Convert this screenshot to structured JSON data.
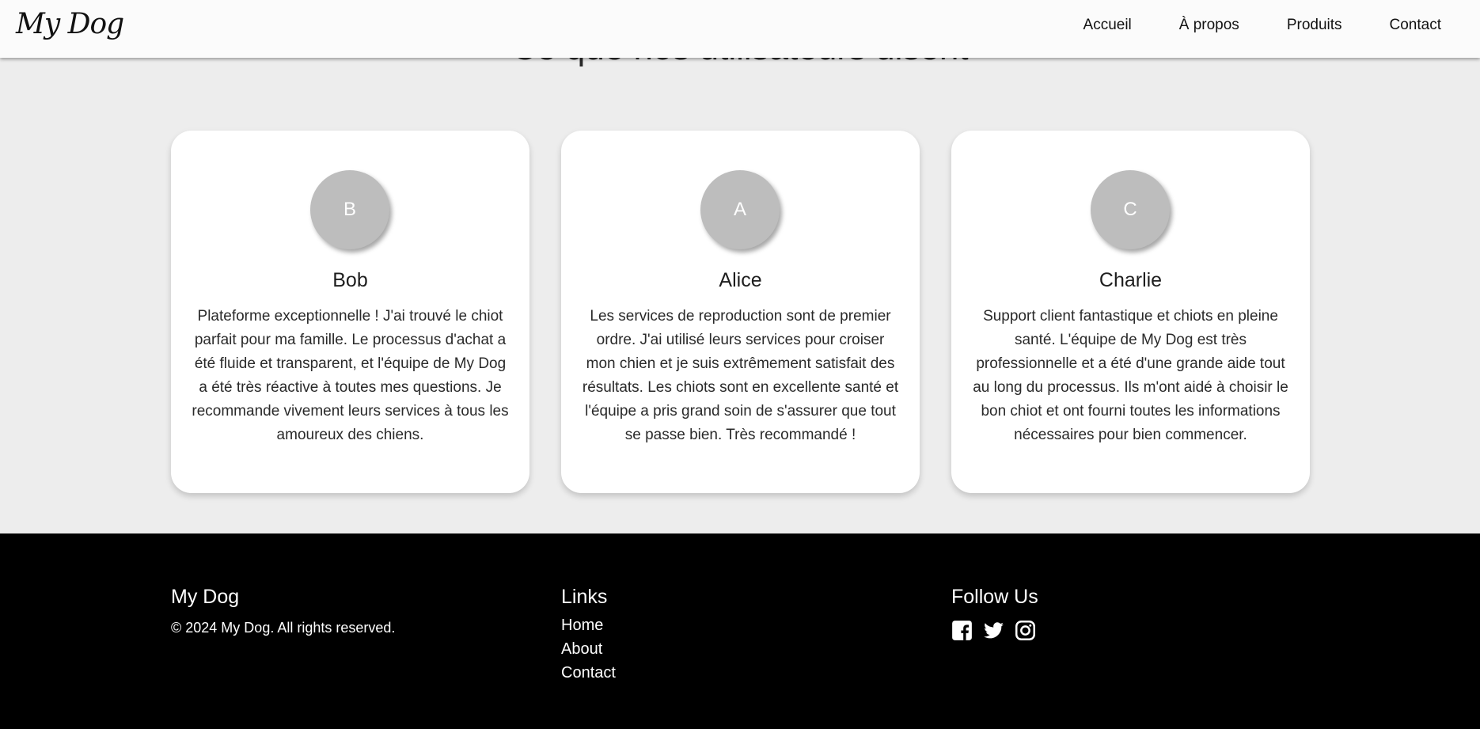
{
  "header": {
    "logo": "My Dog",
    "nav": [
      "Accueil",
      "À propos",
      "Produits",
      "Contact"
    ]
  },
  "section": {
    "title": "Ce que nos utilisateurs disent"
  },
  "testimonials": [
    {
      "initial": "B",
      "name": "Bob",
      "text": "Plateforme exceptionnelle ! J'ai trouvé le chiot parfait pour ma famille. Le processus d'achat a été fluide et transparent, et l'équipe de My Dog a été très réactive à toutes mes questions. Je recommande vivement leurs services à tous les amoureux des chiens."
    },
    {
      "initial": "A",
      "name": "Alice",
      "text": "Les services de reproduction sont de premier ordre. J'ai utilisé leurs services pour croiser mon chien et je suis extrêmement satisfait des résultats. Les chiots sont en excellente santé et l'équipe a pris grand soin de s'assurer que tout se passe bien. Très recommandé !"
    },
    {
      "initial": "C",
      "name": "Charlie",
      "text": "Support client fantastique et chiots en pleine santé. L'équipe de My Dog est très professionnelle et a été d'une grande aide tout au long du processus. Ils m'ont aidé à choisir le bon chiot et ont fourni toutes les informations nécessaires pour bien commencer."
    }
  ],
  "footer": {
    "brand": {
      "title": "My Dog",
      "copyright": "© 2024 My Dog. All rights reserved."
    },
    "links": {
      "title": "Links",
      "items": [
        "Home",
        "About",
        "Contact"
      ]
    },
    "follow": {
      "title": "Follow Us",
      "icons": [
        "facebook-icon",
        "twitter-icon",
        "instagram-icon"
      ]
    }
  },
  "colors": {
    "page_bg": "#ededed",
    "header_bg": "#fbfbfb",
    "card_bg": "#ffffff",
    "avatar_bg": "#bdbdbd",
    "footer_bg": "#000000"
  }
}
